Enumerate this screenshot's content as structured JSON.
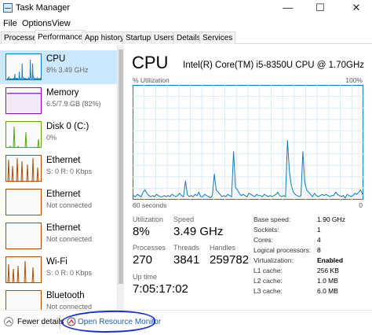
{
  "window": {
    "title": "Task Manager",
    "icon": "task-manager-icon"
  },
  "window_controls": {
    "minimize": "—",
    "maximize": "☐",
    "close": "✕"
  },
  "menu": {
    "items": [
      "File",
      "Options",
      "View"
    ]
  },
  "tabs": [
    "Processes",
    "Performance",
    "App history",
    "Startup",
    "Users",
    "Details",
    "Services"
  ],
  "active_tab": "Performance",
  "sidebar": {
    "items": [
      {
        "title": "CPU",
        "subtitle": "8%  3.49 GHz",
        "color": "#117dbb",
        "selected": true
      },
      {
        "title": "Memory",
        "subtitle": "6.5/7.9 GB (82%)",
        "color": "#8b12ae",
        "usage": 0.82
      },
      {
        "title": "Disk 0 (C:)",
        "subtitle": "0%",
        "color": "#4da60c"
      },
      {
        "title": "Ethernet",
        "subtitle": "S: 0 R: 0 Kbps",
        "color": "#a74f01"
      },
      {
        "title": "Ethernet",
        "subtitle": "Not connected",
        "color": "#a74f01"
      },
      {
        "title": "Ethernet",
        "subtitle": "Not connected",
        "color": "#a74f01"
      },
      {
        "title": "Wi-Fi",
        "subtitle": "S: 0 R: 0 Kbps",
        "color": "#a74f01"
      },
      {
        "title": "Bluetooth",
        "subtitle": "Not connected",
        "color": "#a74f01"
      }
    ]
  },
  "cpu": {
    "title": "CPU",
    "model": "Intel(R) Core(TM) i5-8350U CPU @ 1.70GHz",
    "axis_top_left": "% Utilization",
    "axis_top_right": "100%",
    "axis_bottom_left": "60 seconds",
    "axis_bottom_right": "0",
    "graph_color": "#117dbb",
    "graph_fill": "#f1f6fa",
    "graph_grid": "#d9eaf4",
    "history": [
      3,
      2,
      4,
      3,
      2,
      6,
      8,
      5,
      3,
      2,
      3,
      2,
      4,
      3,
      2,
      2,
      3,
      2,
      3,
      2,
      4,
      3,
      2,
      3,
      5,
      3,
      2,
      16,
      4,
      2,
      3,
      2,
      4,
      3,
      6,
      2,
      2,
      4,
      3,
      2,
      1,
      3,
      22,
      8,
      6,
      4,
      2,
      3,
      2,
      4,
      3,
      2,
      42,
      10,
      8,
      5,
      3,
      4,
      3,
      2,
      5,
      4,
      3,
      2,
      4,
      3,
      3,
      2,
      4,
      3,
      2,
      3,
      2,
      3,
      4,
      6,
      3,
      2,
      3,
      2,
      52,
      24,
      12,
      6,
      4,
      3,
      2,
      3,
      42,
      14,
      8,
      6,
      4,
      2,
      5,
      3,
      2,
      3,
      4,
      3,
      4,
      3,
      2,
      3,
      3,
      6,
      4,
      3,
      2,
      3,
      1,
      4,
      3,
      2,
      3,
      5,
      4,
      6,
      8,
      4
    ],
    "utilization_label": "Utilization",
    "utilization": "8%",
    "speed_label": "Speed",
    "speed": "3.49 GHz",
    "processes_label": "Processes",
    "processes": "270",
    "threads_label": "Threads",
    "threads": "3841",
    "handles_label": "Handles",
    "handles": "259782",
    "uptime_label": "Up time",
    "uptime": "7:05:17:02",
    "info": [
      {
        "label": "Base speed:",
        "value": "1.90 GHz"
      },
      {
        "label": "Sockets:",
        "value": "1"
      },
      {
        "label": "Cores:",
        "value": "4"
      },
      {
        "label": "Logical processors:",
        "value": "8"
      },
      {
        "label": "Virtualization:",
        "value": "Enabled"
      },
      {
        "label": "L1 cache:",
        "value": "256 KB"
      },
      {
        "label": "L2 cache:",
        "value": "1.0 MB"
      },
      {
        "label": "L3 cache:",
        "value": "6.0 MB"
      }
    ]
  },
  "footer": {
    "fewer_details": "Fewer details",
    "open_resource_monitor": "Open Resource Monitor",
    "annotation_color": "#1c2fd0"
  }
}
